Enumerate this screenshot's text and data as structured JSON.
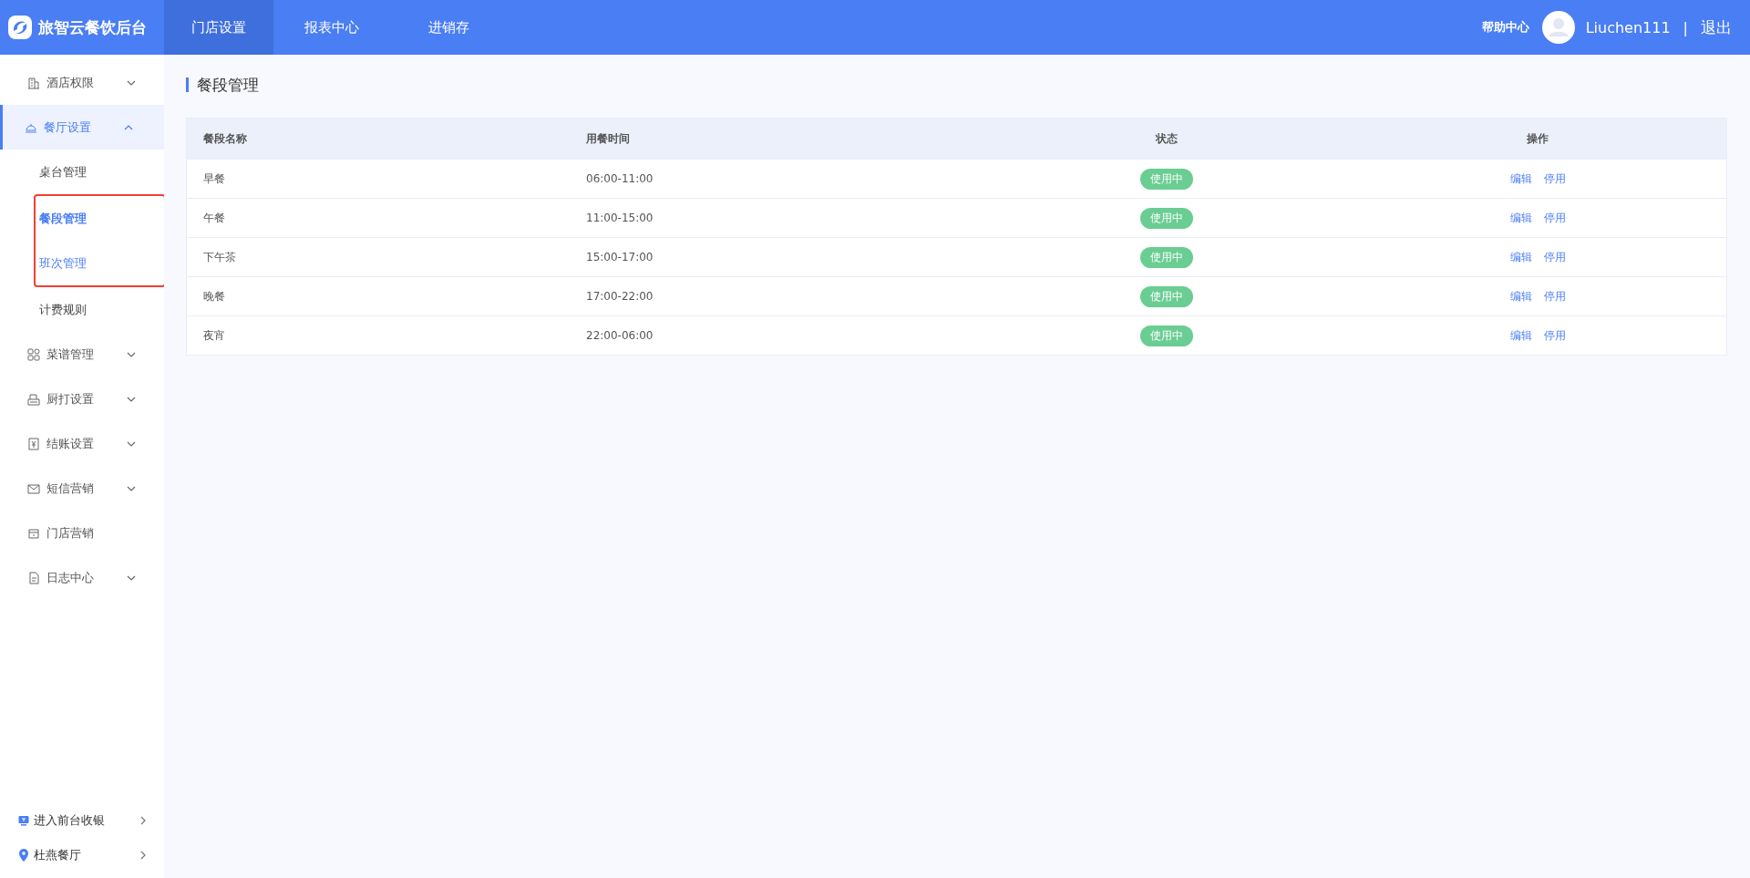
{
  "header": {
    "logo_text": "旅智云餐饮后台",
    "nav": [
      {
        "label": "门店设置",
        "selected": true
      },
      {
        "label": "报表中心",
        "selected": false
      },
      {
        "label": "进销存",
        "selected": false
      }
    ],
    "help": "帮助中心",
    "username": "Liuchen111",
    "separator": "|",
    "logout": "退出"
  },
  "sidebar": {
    "items": [
      {
        "label": "酒店权限",
        "kind": "group",
        "expanded": false,
        "selected": false
      },
      {
        "label": "餐厅设置",
        "kind": "group",
        "expanded": true,
        "selected": true,
        "children": [
          {
            "label": "桌台管理",
            "selected": false,
            "hovered": false,
            "annotated": false
          },
          {
            "label": "餐段管理",
            "selected": true,
            "hovered": false,
            "annotated": true
          },
          {
            "label": "班次管理",
            "selected": false,
            "hovered": true,
            "annotated": true
          },
          {
            "label": "计费规则",
            "selected": false,
            "hovered": false,
            "annotated": false
          }
        ]
      },
      {
        "label": "菜谱管理",
        "kind": "group",
        "expanded": false,
        "selected": false
      },
      {
        "label": "厨打设置",
        "kind": "group",
        "expanded": false,
        "selected": false
      },
      {
        "label": "结账设置",
        "kind": "group",
        "expanded": false,
        "selected": false
      },
      {
        "label": "短信营销",
        "kind": "group",
        "expanded": false,
        "selected": false
      },
      {
        "label": "门店营销",
        "kind": "link",
        "selected": false
      },
      {
        "label": "日志中心",
        "kind": "group",
        "expanded": false,
        "selected": false
      }
    ],
    "footer": [
      {
        "label": "进入前台收银"
      },
      {
        "label": "杜燕餐厅"
      }
    ]
  },
  "page_title": "餐段管理",
  "table": {
    "columns": [
      "餐段名称",
      "用餐时间",
      "状态",
      "操作"
    ],
    "rows": [
      {
        "name": "早餐",
        "time": "06:00-11:00",
        "status": "使用中",
        "actions": [
          "编辑",
          "停用"
        ]
      },
      {
        "name": "午餐",
        "time": "11:00-15:00",
        "status": "使用中",
        "actions": [
          "编辑",
          "停用"
        ]
      },
      {
        "name": "下午茶",
        "time": "15:00-17:00",
        "status": "使用中",
        "actions": [
          "编辑",
          "停用"
        ]
      },
      {
        "name": "晚餐",
        "time": "17:00-22:00",
        "status": "使用中",
        "actions": [
          "编辑",
          "停用"
        ]
      },
      {
        "name": "夜宵",
        "time": "22:00-06:00",
        "status": "使用中",
        "actions": [
          "编辑",
          "停用"
        ]
      }
    ]
  }
}
